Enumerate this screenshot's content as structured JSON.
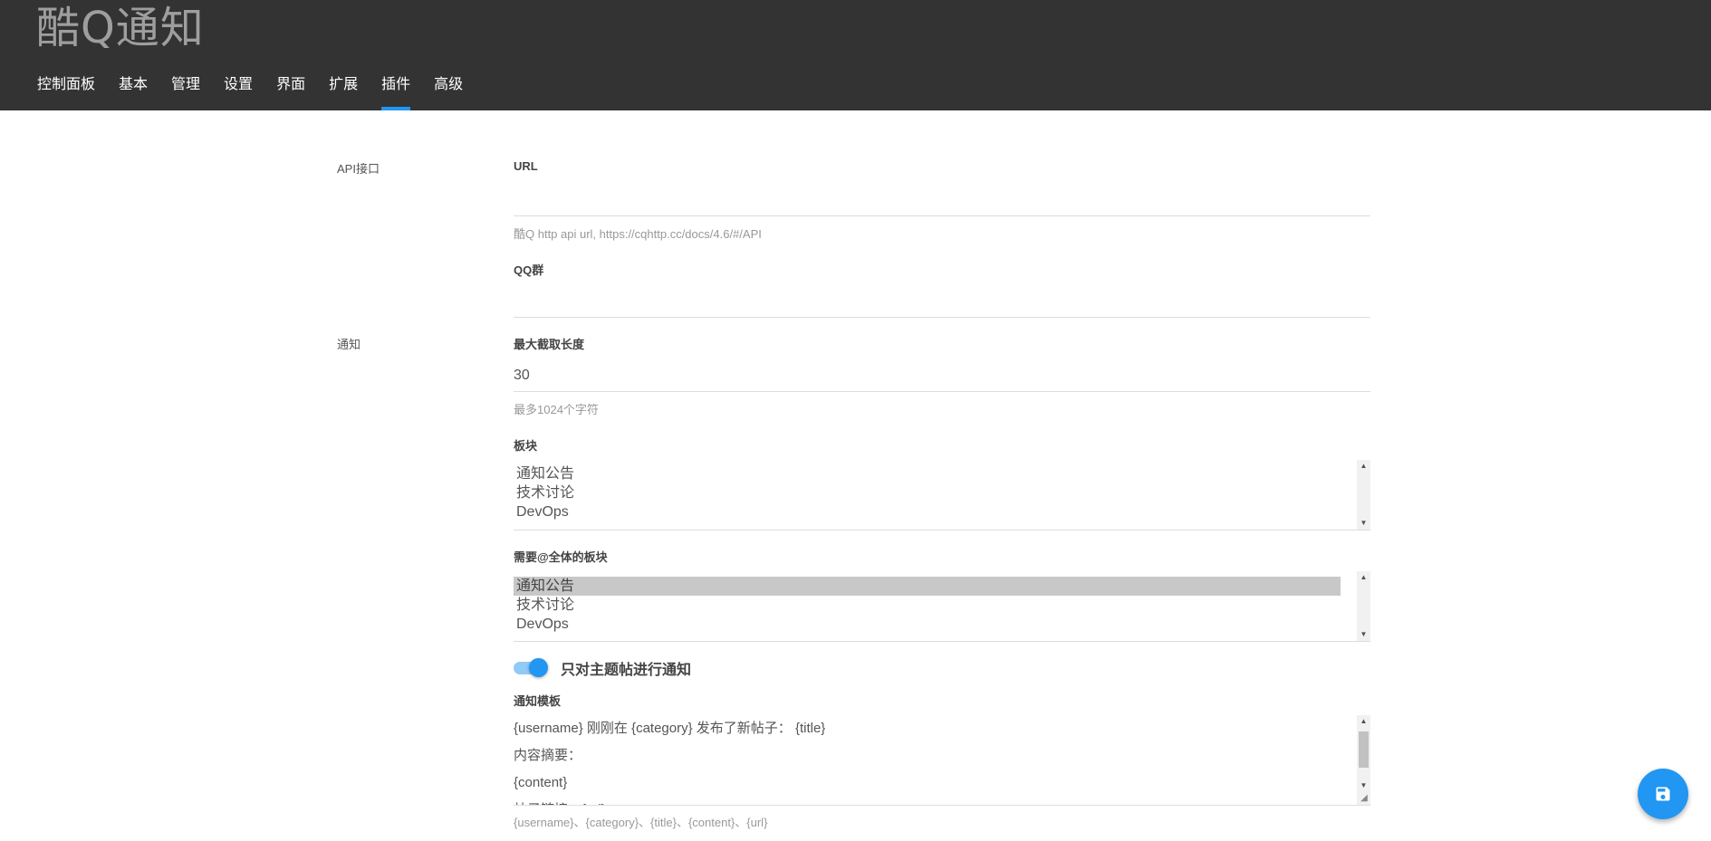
{
  "header": {
    "title": "酷Q通知",
    "tabs": [
      {
        "label": "控制面板",
        "active": false
      },
      {
        "label": "基本",
        "active": false
      },
      {
        "label": "管理",
        "active": false
      },
      {
        "label": "设置",
        "active": false
      },
      {
        "label": "界面",
        "active": false
      },
      {
        "label": "扩展",
        "active": false
      },
      {
        "label": "插件",
        "active": true
      },
      {
        "label": "高级",
        "active": false
      }
    ]
  },
  "api_section": {
    "label": "API接口",
    "url": {
      "label": "URL",
      "value": "",
      "help": "酷Q http api url, https://cqhttp.cc/docs/4.6/#/API"
    },
    "qq_group": {
      "label": "QQ群",
      "value": ""
    }
  },
  "notify_section": {
    "label": "通知",
    "max_length": {
      "label": "最大截取长度",
      "value": "30",
      "help": "最多1024个字符"
    },
    "categories": {
      "label": "板块",
      "options": [
        "通知公告",
        "技术讨论",
        "DevOps"
      ],
      "selected": []
    },
    "at_all_categories": {
      "label": "需要@全体的板块",
      "options": [
        "通知公告",
        "技术讨论",
        "DevOps"
      ],
      "selected": [
        "通知公告"
      ]
    },
    "topic_only": {
      "label": "只对主题帖进行通知",
      "enabled": true
    },
    "template": {
      "label": "通知模板",
      "lines": [
        "{username} 刚刚在 {category} 发布了新帖子： {title}",
        "内容摘要：",
        "{content}",
        "帖子链接：{url}"
      ],
      "help": "{username}、{category}、{title}、{content}、{url}"
    }
  },
  "save_button": {
    "icon": "floppy-disk-icon",
    "color": "#2196f3"
  },
  "colors": {
    "header_bg": "#333333",
    "accent": "#2196f3"
  }
}
